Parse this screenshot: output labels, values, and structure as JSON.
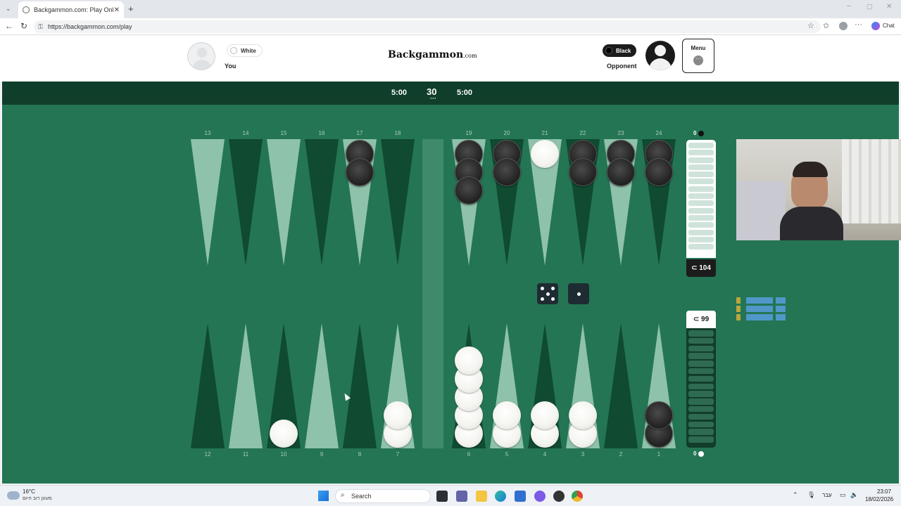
{
  "browser": {
    "tab_title": "Backgammon.com: Play Online Ba",
    "url": "https://backgammon.com/play",
    "chat_label": "Chat"
  },
  "header": {
    "logo_main": "Backgammon",
    "logo_suffix": ".com",
    "player": {
      "name": "You",
      "color_label": "White"
    },
    "opponent": {
      "name": "Opponent",
      "color_label": "Black"
    },
    "menu_label": "Menu"
  },
  "timers": {
    "player": "5:00",
    "match_length": "30",
    "opponent": "5:00"
  },
  "board": {
    "top_points": [
      "13",
      "14",
      "15",
      "16",
      "17",
      "18",
      "19",
      "20",
      "21",
      "22",
      "23",
      "24"
    ],
    "bottom_points": [
      "12",
      "11",
      "10",
      "9",
      "8",
      "7",
      "6",
      "5",
      "4",
      "3",
      "2",
      "1"
    ],
    "positions": [
      {
        "point": 6,
        "color": "white",
        "count": 5
      },
      {
        "point": 5,
        "color": "white",
        "count": 2
      },
      {
        "point": 4,
        "color": "white",
        "count": 2
      },
      {
        "point": 3,
        "color": "white",
        "count": 2
      },
      {
        "point": 7,
        "color": "white",
        "count": 2
      },
      {
        "point": 10,
        "color": "white",
        "count": 1
      },
      {
        "point": 21,
        "color": "white",
        "count": 1
      },
      {
        "point": 1,
        "color": "black",
        "count": 2
      },
      {
        "point": 17,
        "color": "black",
        "count": 2
      },
      {
        "point": 19,
        "color": "black",
        "count": 3
      },
      {
        "point": 20,
        "color": "black",
        "count": 2
      },
      {
        "point": 22,
        "color": "black",
        "count": 2
      },
      {
        "point": 23,
        "color": "black",
        "count": 2
      },
      {
        "point": 24,
        "color": "black",
        "count": 2
      }
    ],
    "dice": [
      5,
      1
    ],
    "top_off_count": "0",
    "bottom_off_count": "0",
    "opponent_pip_count": "104",
    "player_pip_count": "99",
    "pip_symbol": "⊂"
  },
  "colors": {
    "felt": "#247553",
    "bar_dark": "#0f3e2b",
    "point_light": "#8fc2ab",
    "point_dark": "#0f4a31"
  },
  "taskbar": {
    "temperature": "16°C",
    "weather_text": "מעונן רוב היום",
    "search_placeholder": "Search",
    "language": "עבר",
    "time": "23:07",
    "date": "18/02/2026"
  }
}
